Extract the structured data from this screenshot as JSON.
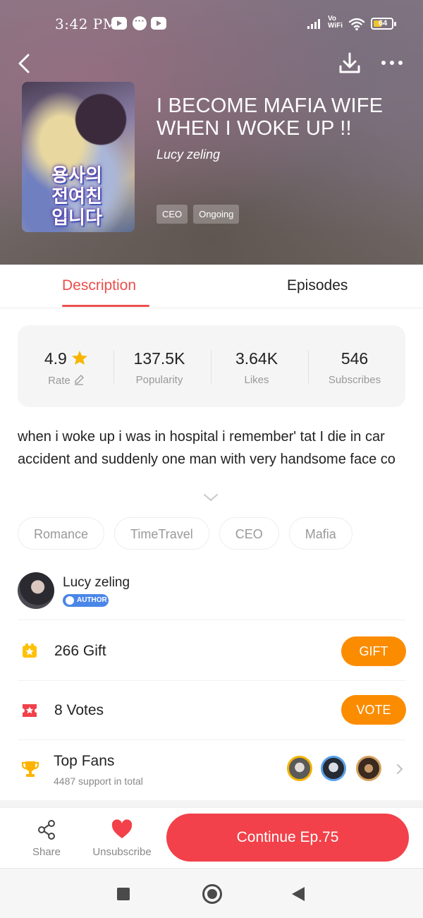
{
  "status_bar": {
    "time": "3:42 PM",
    "network_label": "Vo\nWiFi",
    "battery_level": "64"
  },
  "header": {
    "back_icon": "chevron-left-icon",
    "download_icon": "download-icon",
    "more_icon": "more-horizontal-icon"
  },
  "book": {
    "cover_title": "용사의\n전여친\n입니다",
    "title": "I BECOME MAFIA WIFE WHEN I WOKE UP !!",
    "author": "Lucy zeling",
    "tags": [
      "CEO",
      "Ongoing"
    ]
  },
  "tabs": [
    {
      "label": "Description",
      "active": true
    },
    {
      "label": "Episodes",
      "active": false
    }
  ],
  "stats": [
    {
      "value": "4.9",
      "label": "Rate"
    },
    {
      "value": "137.5K",
      "label": "Popularity"
    },
    {
      "value": "3.64K",
      "label": "Likes"
    },
    {
      "value": "546",
      "label": "Subscribes"
    }
  ],
  "description": "when i woke up i was in hospital i remember'  tat I die in car accident  and suddenly one man with very handsome face co",
  "genres": [
    "Romance",
    "TimeTravel",
    "CEO",
    "Mafia"
  ],
  "author_section": {
    "name": "Lucy zeling",
    "badge": "AUTHOR"
  },
  "gift": {
    "text": "266 Gift",
    "button": "GIFT"
  },
  "votes": {
    "text": "8 Votes",
    "button": "VOTE"
  },
  "top_fans": {
    "title": "Top Fans",
    "subtitle": "4487 support in total"
  },
  "bottom_bar": {
    "share_label": "Share",
    "unsubscribe_label": "Unsubscribe",
    "continue_label": "Continue Ep.75"
  },
  "colors": {
    "accent": "#ec4e4a",
    "button_orange": "#fb8c00",
    "continue_red": "#f2414a",
    "star": "#f7b500"
  }
}
